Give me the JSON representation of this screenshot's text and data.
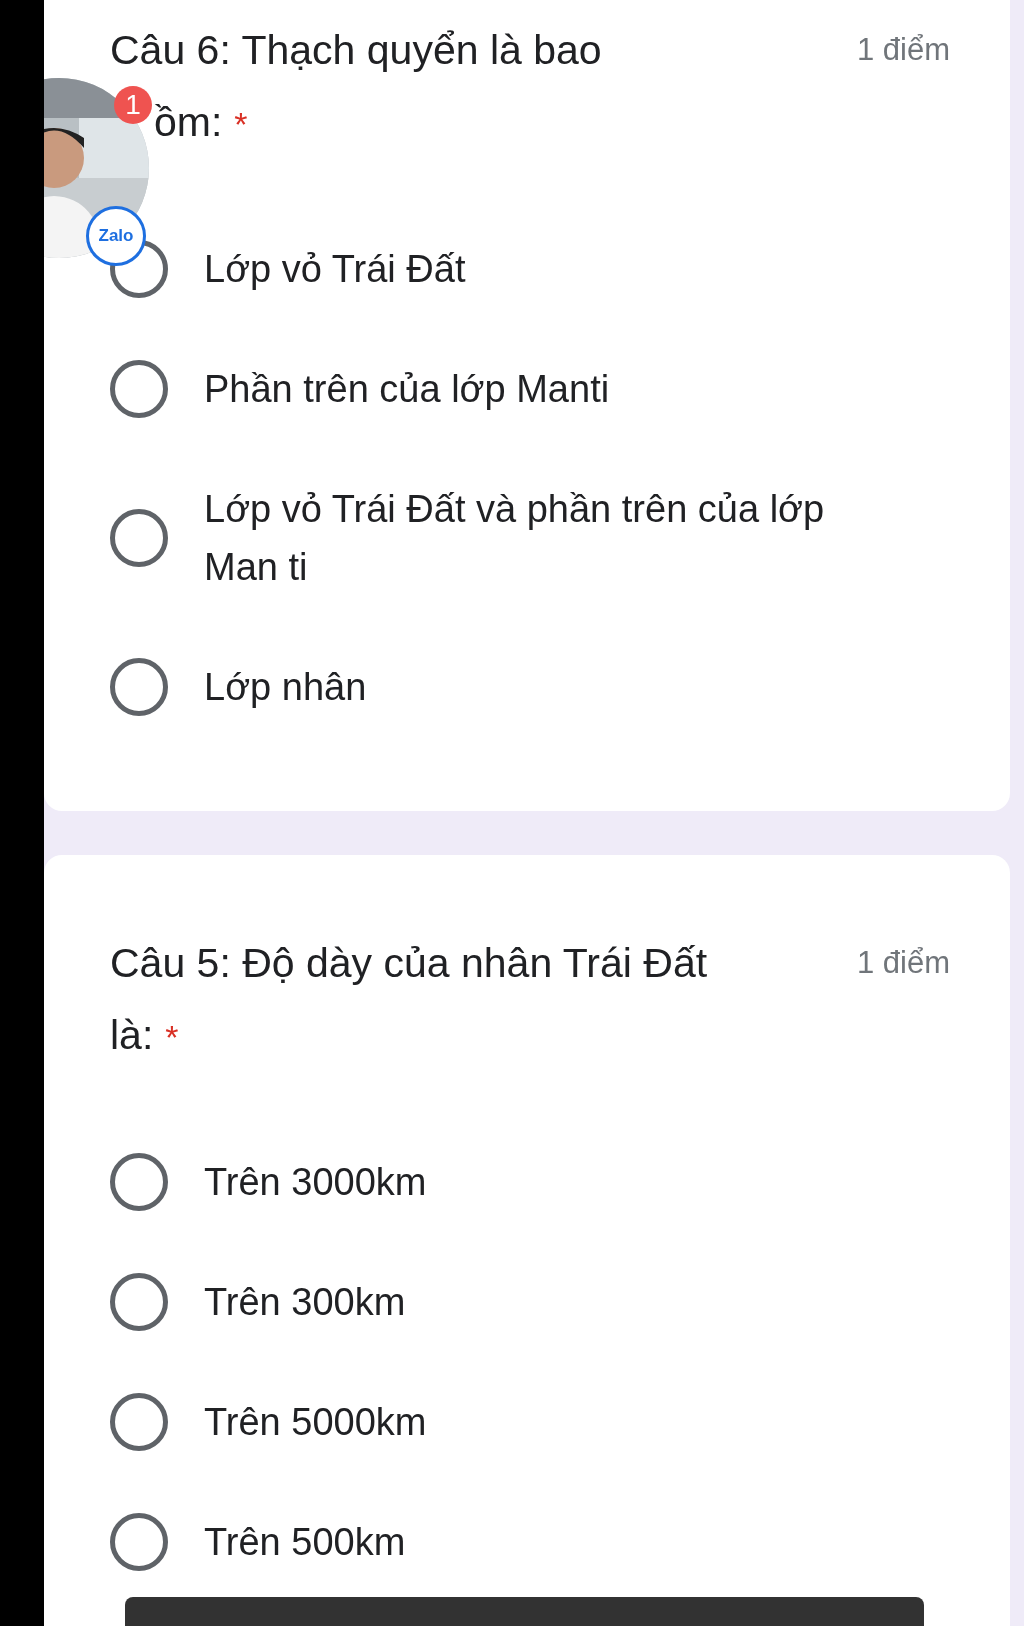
{
  "questions": [
    {
      "title_lines": [
        "Câu 6: Thạch quyển là bao",
        "ồm:"
      ],
      "required_mark": "*",
      "points": "1 điểm",
      "options": [
        {
          "label": "Lớp vỏ Trái Đất",
          "selected": false
        },
        {
          "label": "Phần trên của lớp Manti",
          "selected": false
        },
        {
          "label": "Lớp vỏ Trái Đất và phần trên của lớp Man ti",
          "selected": false
        },
        {
          "label": "Lớp nhân",
          "selected": false
        }
      ]
    },
    {
      "title_lines": [
        "Câu 5: Độ dày của nhân Trái Đất",
        "là:"
      ],
      "required_mark": "*",
      "points": "1 điểm",
      "options": [
        {
          "label": "Trên 3000km",
          "selected": false
        },
        {
          "label": "Trên 300km",
          "selected": false
        },
        {
          "label": "Trên 5000km",
          "selected": false
        },
        {
          "label": "Trên 500km",
          "selected": false
        }
      ]
    }
  ],
  "chat_bubble": {
    "badge": "1",
    "app_label": "Zalo"
  }
}
